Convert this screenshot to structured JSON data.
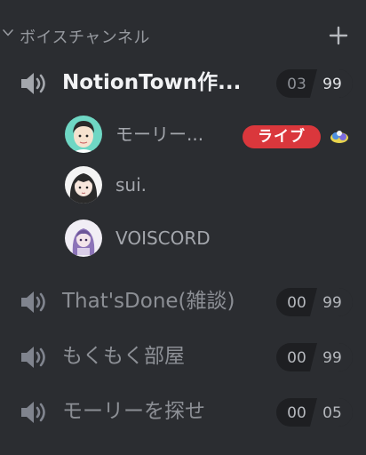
{
  "category": {
    "label": "ボイスチャンネル",
    "add_symbol": "+"
  },
  "channels": [
    {
      "name": "NotionTown作...",
      "current": "03",
      "limit": "99",
      "active": true
    },
    {
      "name": "That'sDone(雑談)",
      "current": "00",
      "limit": "99",
      "active": false
    },
    {
      "name": "もくもく部屋",
      "current": "00",
      "limit": "99",
      "active": false
    },
    {
      "name": "モーリーを探せ",
      "current": "00",
      "limit": "05",
      "active": false
    }
  ],
  "voice_users": [
    {
      "name": "モーリー...",
      "live": true,
      "live_label": "ライブ",
      "activity_icon": "game-activity-icon"
    },
    {
      "name": "sui.",
      "live": false
    },
    {
      "name": "VOISCORD",
      "live": false
    }
  ],
  "colors": {
    "background": "#2b2d31",
    "live_red": "#da373c",
    "active_text": "#f2f3f5",
    "muted_text": "#8c8f95",
    "count_bg": "#1e1f22"
  },
  "icons": [
    "chevron-down-icon",
    "plus-icon",
    "speaker-icon"
  ]
}
